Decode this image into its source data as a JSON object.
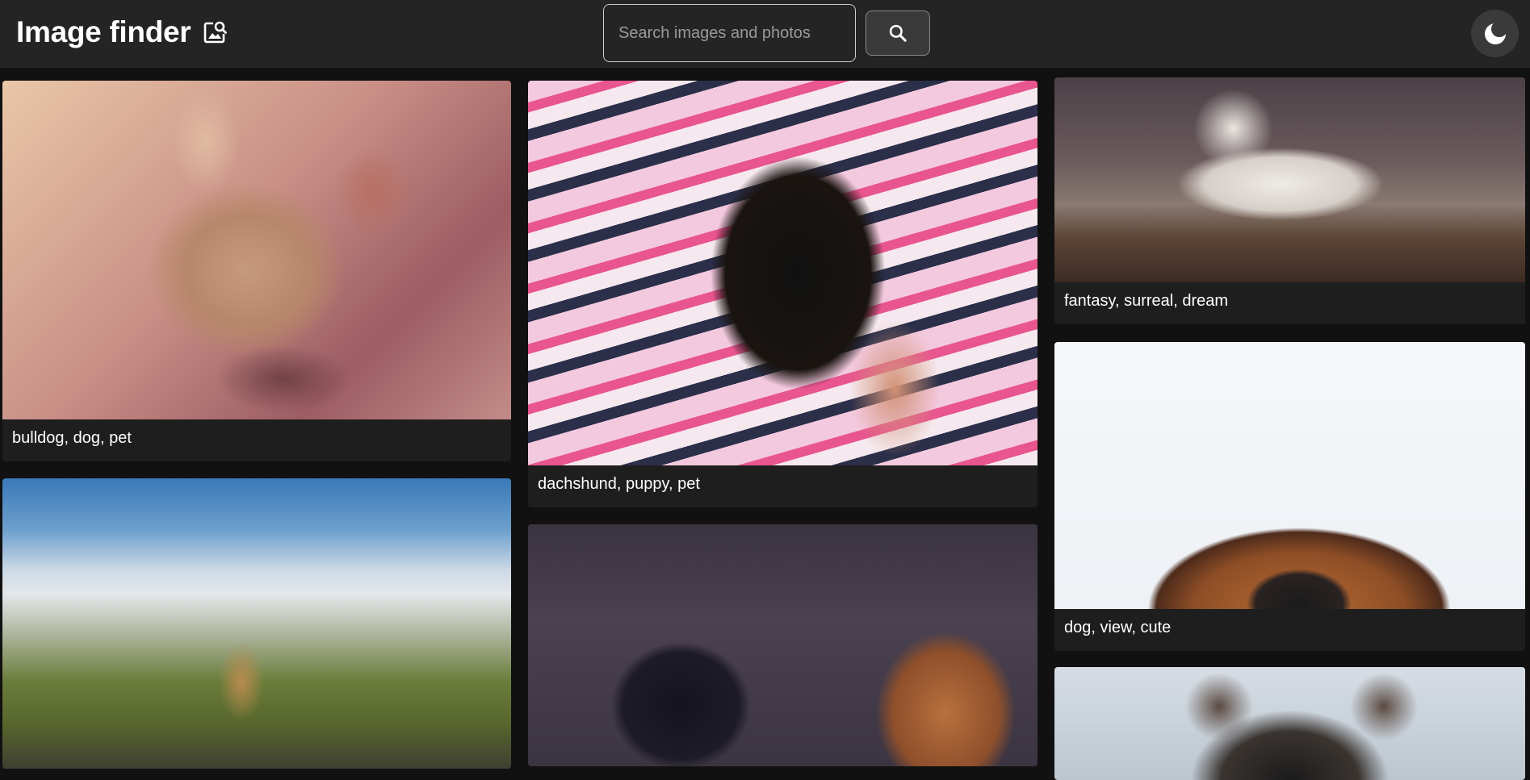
{
  "header": {
    "title": "Image finder",
    "title_icon": "image-search-icon",
    "search": {
      "placeholder": "Search images and photos",
      "value": ""
    },
    "search_button_icon": "search-icon",
    "theme_toggle_icon": "moon-icon"
  },
  "gallery": {
    "columns": [
      {
        "items": [
          {
            "caption": "bulldog, dog, pet"
          },
          {
            "caption": ""
          }
        ]
      },
      {
        "items": [
          {
            "caption": "dachshund, puppy, pet"
          },
          {
            "caption": ""
          }
        ]
      },
      {
        "items": [
          {
            "caption": "fantasy, surreal, dream"
          },
          {
            "caption": "dog, view, cute"
          },
          {
            "caption": ""
          }
        ]
      }
    ]
  },
  "colors": {
    "header_bg": "#242424",
    "page_bg": "#111111",
    "card_bg": "#1e1e1e",
    "text": "#ffffff"
  }
}
